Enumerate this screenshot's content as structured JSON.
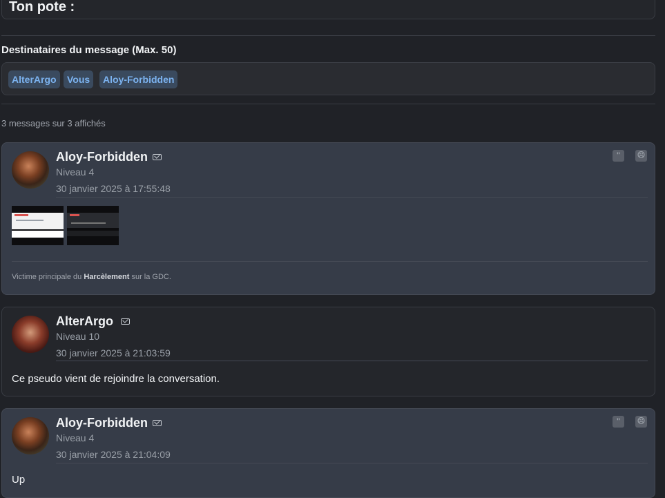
{
  "header": {
    "title": "Ton pote :"
  },
  "recipients": {
    "label": "Destinataires du message (Max. 50)",
    "tags": [
      "AlterArgo",
      "Vous",
      "Aloy-Forbidden"
    ]
  },
  "messages_count": "3 messages sur 3 affichés",
  "messages": [
    {
      "author": "Aloy-Forbidden",
      "level": "Niveau 4",
      "date": "30 janvier 2025 à 17:55:48",
      "signature": {
        "prefix": "Victime principale du ",
        "bold": "Harcèlement",
        "suffix": " sur la GDC."
      }
    },
    {
      "author": "AlterArgo",
      "level": "Niveau 10",
      "date": "30 janvier 2025 à 21:03:59",
      "text": "Ce pseudo vient de rejoindre la conversation."
    },
    {
      "author": "Aloy-Forbidden",
      "level": "Niveau 4",
      "date": "30 janvier 2025 à 21:04:09",
      "text": "Up"
    }
  ],
  "icons": {
    "quote": "quote-icon",
    "report": "report-icon",
    "mail": "mail-icon"
  }
}
